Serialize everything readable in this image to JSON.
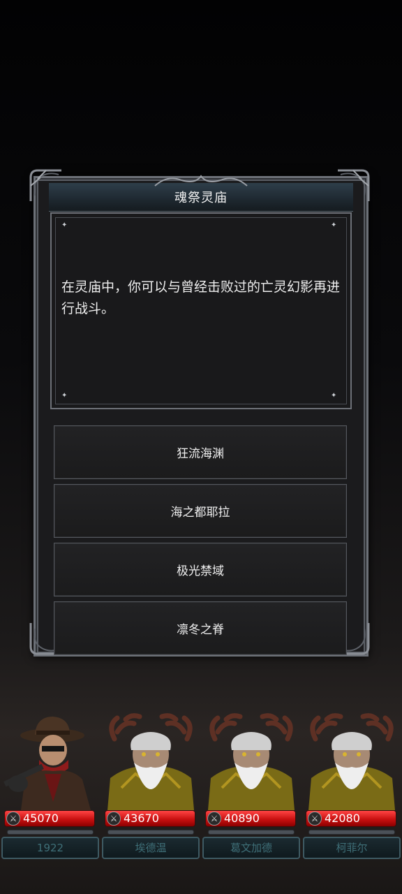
{
  "dialog": {
    "title": "魂祭灵庙",
    "description": "在灵庙中，你可以与曾经击败过的亡灵幻影再进行战斗。"
  },
  "options": [
    {
      "label": "狂流海渊"
    },
    {
      "label": "海之都耶拉"
    },
    {
      "label": "极光禁域"
    },
    {
      "label": "凛冬之脊"
    }
  ],
  "party": [
    {
      "name": "1922",
      "hp": "45070",
      "portrait": "cowboy-hunter"
    },
    {
      "name": "埃德温",
      "hp": "43670",
      "portrait": "antlered-elder"
    },
    {
      "name": "葛文加德",
      "hp": "40890",
      "portrait": "antlered-elder"
    },
    {
      "name": "柯菲尔",
      "hp": "42080",
      "portrait": "antlered-elder"
    }
  ],
  "icons": {
    "hp": "sword-icon"
  },
  "colors": {
    "hp_bar": "#c81010",
    "name_text": "#3f6f78",
    "frame": "#6c7077"
  }
}
